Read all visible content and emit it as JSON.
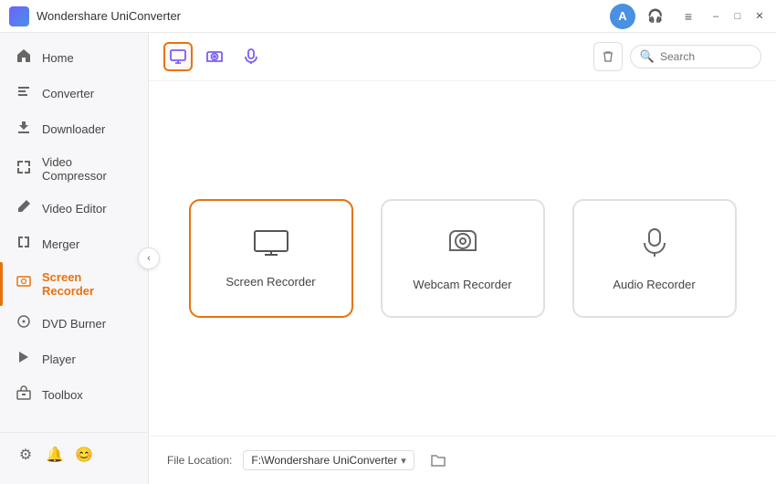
{
  "titleBar": {
    "appName": "Wondershare UniConverter",
    "avatarInitial": "A",
    "icons": {
      "headset": "🎧",
      "menu": "≡",
      "minimize": "–",
      "maximize": "□",
      "close": "✕"
    }
  },
  "sidebar": {
    "items": [
      {
        "id": "home",
        "label": "Home",
        "icon": "home"
      },
      {
        "id": "converter",
        "label": "Converter",
        "icon": "converter"
      },
      {
        "id": "downloader",
        "label": "Downloader",
        "icon": "downloader"
      },
      {
        "id": "video-compressor",
        "label": "Video Compressor",
        "icon": "compress"
      },
      {
        "id": "video-editor",
        "label": "Video Editor",
        "icon": "editor"
      },
      {
        "id": "merger",
        "label": "Merger",
        "icon": "merger"
      },
      {
        "id": "screen-recorder",
        "label": "Screen Recorder",
        "icon": "screen-recorder",
        "active": true
      },
      {
        "id": "dvd-burner",
        "label": "DVD Burner",
        "icon": "dvd"
      },
      {
        "id": "player",
        "label": "Player",
        "icon": "player"
      },
      {
        "id": "toolbox",
        "label": "Toolbox",
        "icon": "toolbox"
      }
    ],
    "bottomIcons": [
      "settings",
      "bell",
      "help"
    ]
  },
  "toolbar": {
    "tabs": [
      {
        "id": "screen",
        "icon": "screen",
        "active": true
      },
      {
        "id": "webcam",
        "icon": "webcam"
      },
      {
        "id": "audio",
        "icon": "audio"
      }
    ],
    "search": {
      "placeholder": "Search"
    }
  },
  "cards": [
    {
      "id": "screen-recorder",
      "label": "Screen Recorder",
      "icon": "monitor",
      "selected": true
    },
    {
      "id": "webcam-recorder",
      "label": "Webcam Recorder",
      "icon": "webcam"
    },
    {
      "id": "audio-recorder",
      "label": "Audio Recorder",
      "icon": "mic"
    }
  ],
  "footer": {
    "locationLabel": "File Location:",
    "path": "F:\\Wondershare UniConverter",
    "dropdownArrow": "▾"
  }
}
